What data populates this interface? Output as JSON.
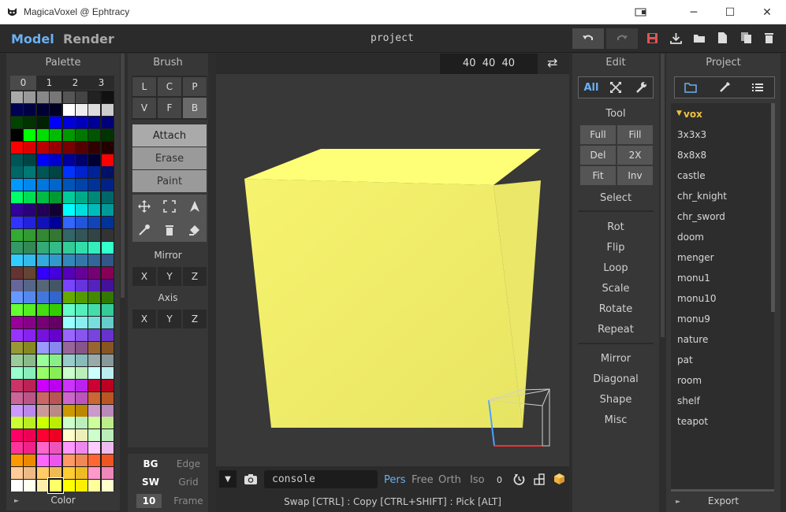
{
  "window": {
    "title": "MagicaVoxel @ Ephtracy",
    "minimize": "─",
    "maximize": "☐",
    "close": "✕"
  },
  "menu": {
    "model": "Model",
    "render": "Render",
    "file_title": "project"
  },
  "palette": {
    "title": "Palette",
    "tabs": [
      "0",
      "1",
      "2",
      "3"
    ],
    "footer": "Color",
    "footer_arrow": "►",
    "rows": [
      [
        "#aaaaaa",
        "#999999",
        "#888888",
        "#777777",
        "#555555",
        "#444444",
        "#222222",
        "#111111"
      ],
      [
        "#000055",
        "#000044",
        "#000033",
        "#000022",
        "#ffffff",
        "#eeeeee",
        "#dddddd",
        "#cccccc"
      ],
      [
        "#004400",
        "#003300",
        "#002200",
        "#0000ff",
        "#0000dd",
        "#0000bb",
        "#000099",
        "#000077"
      ],
      [
        "#000000",
        "#00ff00",
        "#00dd00",
        "#00bb00",
        "#009900",
        "#007700",
        "#005500",
        "#003300"
      ],
      [
        "#ff0000",
        "#dd0000",
        "#bb0000",
        "#990000",
        "#770000",
        "#550000",
        "#330000",
        "#220000"
      ],
      [
        "#005555",
        "#004444",
        "#0000ff",
        "#0000cc",
        "#000099",
        "#000066",
        "#000033",
        "#ff0000"
      ],
      [
        "#006666",
        "#007777",
        "#005555",
        "#004444",
        "#0033ff",
        "#0022cc",
        "#002299",
        "#001166"
      ],
      [
        "#0099ff",
        "#0088ee",
        "#0077dd",
        "#0066cc",
        "#0055bb",
        "#0044aa",
        "#003399",
        "#002288"
      ],
      [
        "#00ff66",
        "#00dd55",
        "#00bb44",
        "#009933",
        "#00cc99",
        "#00aa88",
        "#008877",
        "#006666"
      ],
      [
        "#330099",
        "#2a0077",
        "#220055",
        "#110033",
        "#00ffff",
        "#00dddd",
        "#00bbbb",
        "#009999"
      ],
      [
        "#3333ff",
        "#2222dd",
        "#1111bb",
        "#000099",
        "#3366ff",
        "#2255dd",
        "#1144bb",
        "#003399"
      ],
      [
        "#33aa33",
        "#339933",
        "#338833",
        "#337733",
        "#336666",
        "#335555",
        "#334444",
        "#333333"
      ],
      [
        "#339966",
        "#338855",
        "#33aa77",
        "#33bb88",
        "#33cc99",
        "#33ddaa",
        "#33eebb",
        "#33ffcc"
      ],
      [
        "#33ccff",
        "#33bbee",
        "#33aadd",
        "#3399cc",
        "#3388bb",
        "#3377aa",
        "#336699",
        "#335588"
      ],
      [
        "#663333",
        "#664433",
        "#3300ff",
        "#4400dd",
        "#5500bb",
        "#660099",
        "#770077",
        "#880055"
      ],
      [
        "#666699",
        "#556688",
        "#556677",
        "#445566",
        "#7744ff",
        "#6633dd",
        "#5522bb",
        "#441199"
      ],
      [
        "#6699ff",
        "#5588ee",
        "#4477dd",
        "#3366cc",
        "#66aa00",
        "#559900",
        "#448800",
        "#337700"
      ],
      [
        "#66ff33",
        "#55ee22",
        "#44dd11",
        "#33cc00",
        "#66ffcc",
        "#55eebb",
        "#44ddaa",
        "#33cc99"
      ],
      [
        "#990099",
        "#880088",
        "#770077",
        "#660066",
        "#99ffff",
        "#88eeee",
        "#77dddd",
        "#66cccc"
      ],
      [
        "#9933ff",
        "#8822ee",
        "#7711dd",
        "#6600cc",
        "#9966ff",
        "#8855ee",
        "#7744dd",
        "#6633cc"
      ],
      [
        "#999933",
        "#888822",
        "#9999ff",
        "#8888ee",
        "#996699",
        "#885588",
        "#996633",
        "#885522"
      ],
      [
        "#99cc99",
        "#88bb88",
        "#99ff99",
        "#88ee88",
        "#99cccc",
        "#88bbbb",
        "#99aaaa",
        "#889999"
      ],
      [
        "#99ffcc",
        "#88eebb",
        "#99ff66",
        "#88ee55",
        "#ccffcc",
        "#bbeebb",
        "#ccffff",
        "#bbeeee"
      ],
      [
        "#cc3366",
        "#bb2255",
        "#cc00ff",
        "#bb00ee",
        "#cc33ff",
        "#bb22ee",
        "#cc0033",
        "#bb0022"
      ],
      [
        "#cc6699",
        "#bb5588",
        "#cc6666",
        "#bb5555",
        "#cc66cc",
        "#bb55bb",
        "#cc6633",
        "#bb5522"
      ],
      [
        "#cc99ff",
        "#bb88ee",
        "#cc9999",
        "#bb8888",
        "#cc9900",
        "#bb8800",
        "#cc99cc",
        "#bb88bb"
      ],
      [
        "#ccff33",
        "#bbee22",
        "#ccff00",
        "#bbee00",
        "#ccffcc",
        "#bbeebb",
        "#ccff99",
        "#bbee88"
      ],
      [
        "#ff0066",
        "#ee0055",
        "#ff0033",
        "#ee0022",
        "#ffffcc",
        "#eeeebb",
        "#ccffcc",
        "#bbeebb"
      ],
      [
        "#ff3399",
        "#ee2288",
        "#ff66cc",
        "#ee55bb",
        "#ff99ff",
        "#ee88ee",
        "#ffccff",
        "#eebbee"
      ],
      [
        "#ff9900",
        "#ee8800",
        "#ff66ff",
        "#ee55ee",
        "#ff9966",
        "#ee8855",
        "#ff6633",
        "#ee5522"
      ],
      [
        "#ffcc99",
        "#eebb88",
        "#ffcc66",
        "#eebb55",
        "#ffcc33",
        "#eebb22",
        "#ff99cc",
        "#ee88bb"
      ],
      [
        "#ffffff",
        "#ffffee",
        "#ffeeaa",
        "#ffff66",
        "#ffff00",
        "#ffee00",
        "#ffff99",
        "#ffffcc"
      ]
    ],
    "selected_color": "#ffff66"
  },
  "brush": {
    "title": "Brush",
    "types": [
      "L",
      "C",
      "P",
      "V",
      "F",
      "B"
    ],
    "modes": [
      "Attach",
      "Erase",
      "Paint"
    ],
    "mirror_title": "Mirror",
    "axis_title": "Axis",
    "mirror_axes": [
      "X",
      "Y",
      "Z"
    ],
    "axis_axes": [
      "X",
      "Y",
      "Z"
    ]
  },
  "display": {
    "bg": "BG",
    "edge": "Edge",
    "sw": "SW",
    "grid": "Grid",
    "frame_value": "10",
    "frame": "Frame"
  },
  "viewport": {
    "size": "40  40  40",
    "swap_icon": "⇄",
    "console": "console",
    "cams": [
      "Pers",
      "Free",
      "Orth",
      "Iso"
    ],
    "counter": "0",
    "hint": "Swap [CTRL] : Copy [CTRL+SHIFT] : Pick [ALT]",
    "cube_color": "#ffff77"
  },
  "edit": {
    "title": "Edit",
    "all": "All",
    "tool_title": "Tool",
    "tools": [
      "Full",
      "Fill",
      "Del",
      "2X",
      "Fit",
      "Inv"
    ],
    "select": "Select",
    "actions": [
      "Rot",
      "Flip",
      "Loop",
      "Scale",
      "Rotate",
      "Repeat"
    ],
    "actions2": [
      "Mirror",
      "Diagonal",
      "Shape",
      "Misc"
    ]
  },
  "project": {
    "title": "Project",
    "folder": "vox",
    "folder_arrow": "▼",
    "items": [
      "3x3x3",
      "8x8x8",
      "castle",
      "chr_knight",
      "chr_sword",
      "doom",
      "menger",
      "monu1",
      "monu10",
      "monu9",
      "nature",
      "pat",
      "room",
      "shelf",
      "teapot"
    ],
    "export": "Export",
    "export_arrow": "►"
  },
  "colors": {
    "accent": "#6ab0f3",
    "save": "#e05555",
    "folder": "#f0c040"
  }
}
